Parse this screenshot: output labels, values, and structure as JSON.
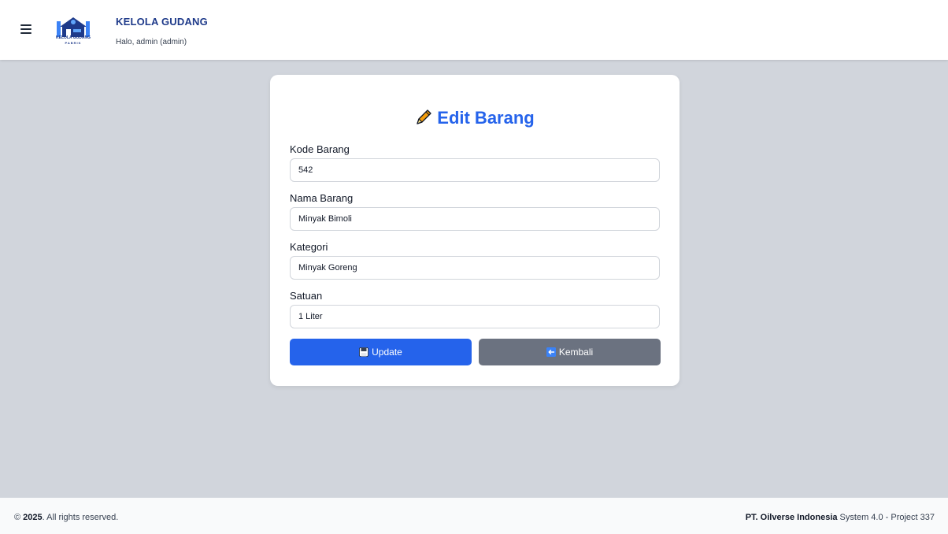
{
  "header": {
    "app_title": "KELOLA GUDANG",
    "greeting": "Halo, admin (admin)",
    "logo_text_top": "KELOLA GUDANG",
    "logo_text_bottom": "PABRIK"
  },
  "form": {
    "title": "Edit Barang",
    "fields": [
      {
        "label": "Kode Barang",
        "value": "542"
      },
      {
        "label": "Nama Barang",
        "value": "Minyak Bimoli"
      },
      {
        "label": "Kategori",
        "value": "Minyak Goreng"
      },
      {
        "label": "Satuan",
        "value": "1 Liter"
      }
    ],
    "update_label": "Update",
    "back_label": "Kembali"
  },
  "footer": {
    "copyright_symbol": "©",
    "year": "2025",
    "rights": ". All rights reserved.",
    "company": "PT. Oilverse Indonesia",
    "version": " System 4.0 - Project 337"
  },
  "colors": {
    "accent": "#2563eb",
    "secondary_button": "#6b7280",
    "background": "#d1d5dc"
  },
  "icons": {
    "menu": "hamburger-icon",
    "title": "pencil-icon",
    "update": "floppy-disk-icon",
    "back": "back-arrow-icon"
  }
}
